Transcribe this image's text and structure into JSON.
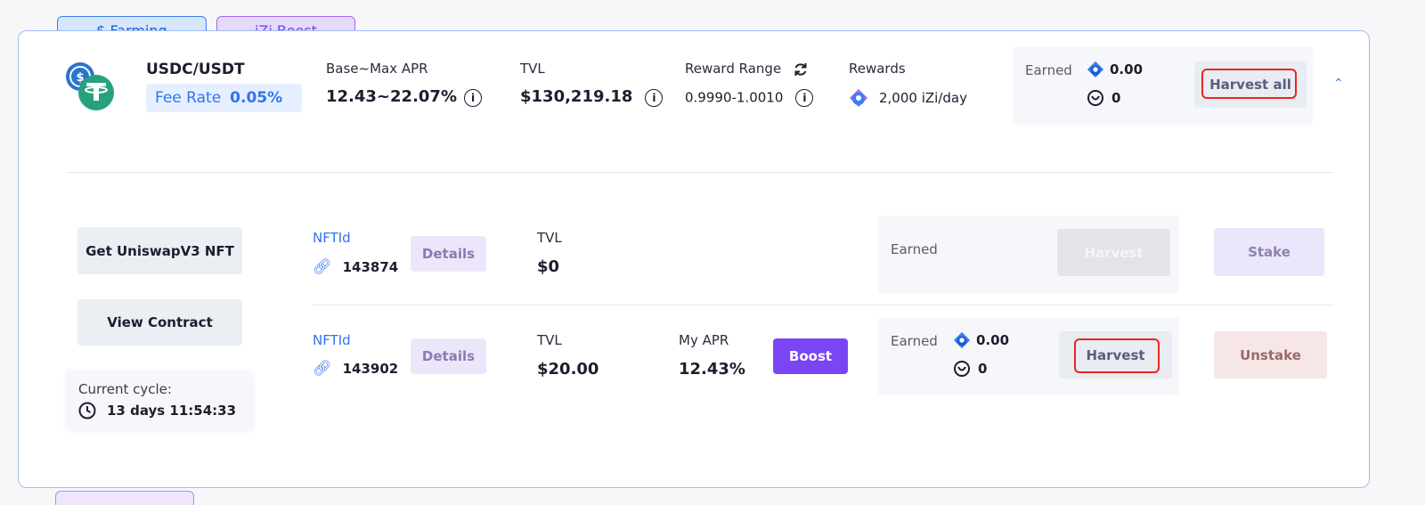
{
  "tags": {
    "farming": "$ Farming",
    "boost": "iZi Boost"
  },
  "pool": {
    "pair": "USDC/USDT",
    "fee_rate_label": "Fee Rate",
    "fee_rate_value": "0.05%",
    "apr_label": "Base~Max APR",
    "apr_value": "12.43~22.07%",
    "tvl_label": "TVL",
    "tvl_value": "$130,219.18",
    "reward_range_label": "Reward Range",
    "reward_range_value": "0.9990-1.0010",
    "rewards_label": "Rewards",
    "rewards_value": "2,000 iZi/day",
    "earned_label": "Earned",
    "earned_izi": "0.00",
    "earned_other": "0",
    "harvest_all_label": "Harvest all"
  },
  "sidebar": {
    "get_nft_label": "Get UniswapV3 NFT",
    "view_contract_label": "View Contract",
    "cycle_label": "Current cycle:",
    "cycle_value": "13 days 11:54:33"
  },
  "positions": [
    {
      "nft_label": "NFTId",
      "nft_id": "143874",
      "details_label": "Details",
      "tvl_label": "TVL",
      "tvl_value": "$0",
      "earned_label": "Earned",
      "harvest_label": "Harvest",
      "action_label": "Stake"
    },
    {
      "nft_label": "NFTId",
      "nft_id": "143902",
      "details_label": "Details",
      "tvl_label": "TVL",
      "tvl_value": "$20.00",
      "apr_label": "My APR",
      "apr_value": "12.43%",
      "boost_label": "Boost",
      "earned_label": "Earned",
      "earned_izi": "0.00",
      "earned_other": "0",
      "harvest_label": "Harvest",
      "action_label": "Unstake"
    }
  ],
  "colors": {
    "accent_blue": "#2f74f0",
    "accent_purple": "#7a45f5",
    "highlight_red": "#e8261d"
  }
}
